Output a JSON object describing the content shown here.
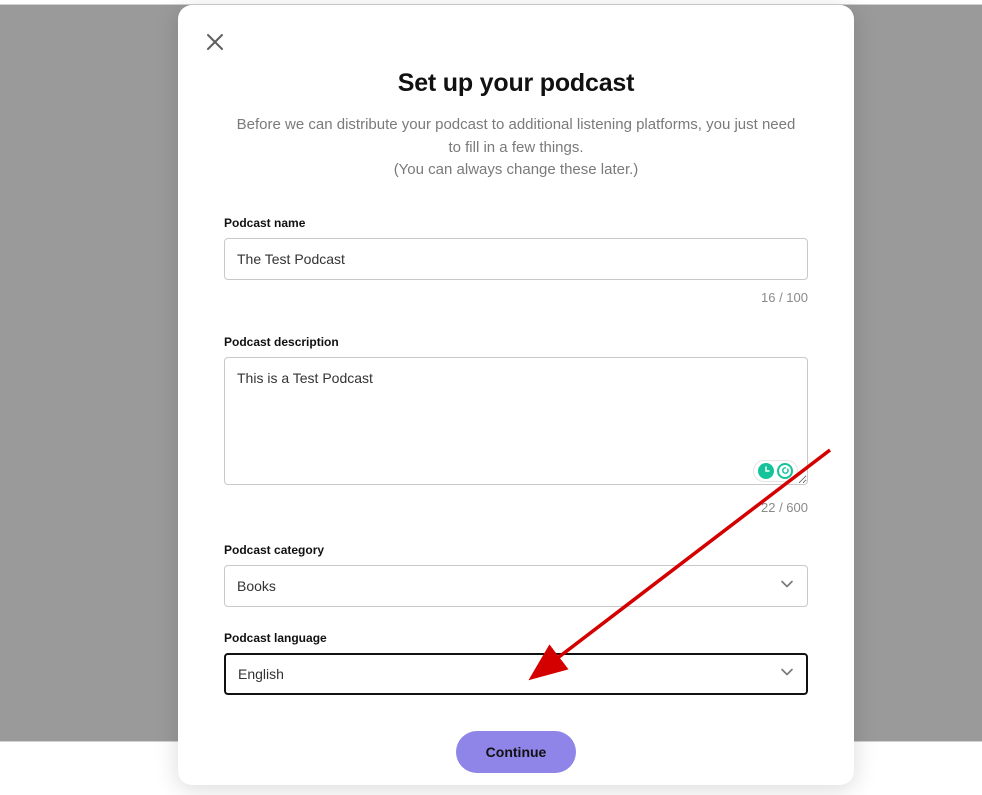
{
  "modal": {
    "title": "Set up your podcast",
    "subtitle_line1": "Before we can distribute your podcast to additional listening platforms, you just need to fill in a few things.",
    "subtitle_line2": "(You can always change these later.)"
  },
  "form": {
    "name": {
      "label": "Podcast name",
      "value": "The Test Podcast",
      "counter": "16  /  100"
    },
    "description": {
      "label": "Podcast description",
      "value": "This is a Test Podcast",
      "counter": "22  /  600"
    },
    "category": {
      "label": "Podcast category",
      "value": "Books"
    },
    "language": {
      "label": "Podcast language",
      "value": "English"
    }
  },
  "buttons": {
    "continue": "Continue"
  },
  "icons": {
    "close": "close",
    "chevron": "chevron-down",
    "grammarly": "grammarly"
  }
}
